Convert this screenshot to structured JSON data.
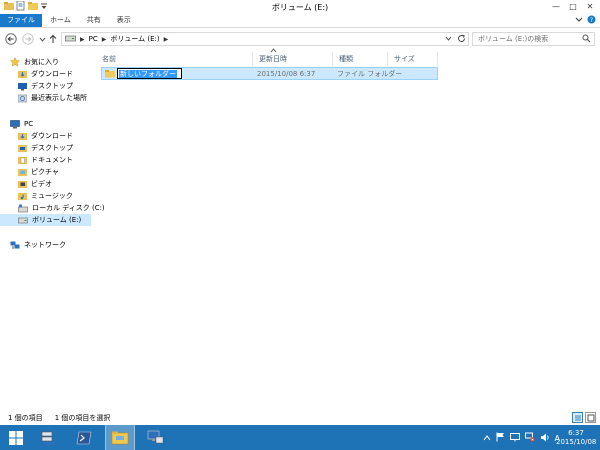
{
  "window": {
    "title": "ボリューム (E:)",
    "controls": {
      "minimize": "—",
      "maximize": "□",
      "close": "✕"
    }
  },
  "ribbon": {
    "tabs": [
      {
        "label": "ファイル"
      },
      {
        "label": "ホーム"
      },
      {
        "label": "共有"
      },
      {
        "label": "表示"
      }
    ]
  },
  "address": {
    "crumbs": [
      "PC",
      "ボリューム (E:)"
    ]
  },
  "search": {
    "placeholder": "ボリューム (E:)の検索"
  },
  "nav": {
    "favorites": {
      "label": "お気に入り",
      "items": [
        "ダウンロード",
        "デスクトップ",
        "最近表示した場所"
      ]
    },
    "pc": {
      "label": "PC",
      "items": [
        "ダウンロード",
        "デスクトップ",
        "ドキュメント",
        "ピクチャ",
        "ビデオ",
        "ミュージック",
        "ローカル ディスク (C:)",
        "ボリューム (E:)"
      ]
    },
    "network": {
      "label": "ネットワーク"
    }
  },
  "columns": [
    "名前",
    "更新日時",
    "種類",
    "サイズ"
  ],
  "files": [
    {
      "name": "新しいフォルダー",
      "modified": "2015/10/08 6:37",
      "type": "ファイル フォルダー",
      "size": ""
    }
  ],
  "status": {
    "item_count": "1 個の項目",
    "selected": "1 個の項目を選択"
  },
  "taskbar": {
    "clock_time": "6:37",
    "clock_date": "2015/10/08",
    "ime": "A"
  },
  "colors": {
    "accent": "#1979ca",
    "taskbar": "#1e73b7",
    "selection": "#cce8ff",
    "selection_border": "#99d1ff"
  }
}
